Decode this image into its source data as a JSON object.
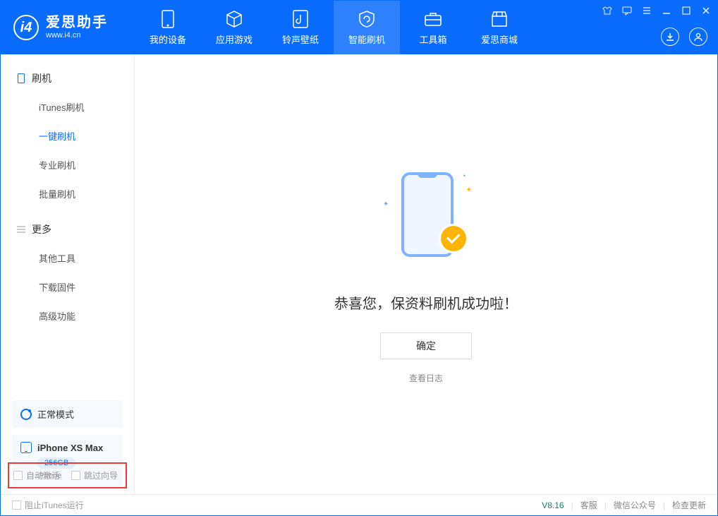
{
  "app": {
    "title": "爱思助手",
    "subtitle": "www.i4.cn"
  },
  "nav": {
    "items": [
      {
        "label": "我的设备"
      },
      {
        "label": "应用游戏"
      },
      {
        "label": "铃声壁纸"
      },
      {
        "label": "智能刷机"
      },
      {
        "label": "工具箱"
      },
      {
        "label": "爱思商城"
      }
    ]
  },
  "sidebar": {
    "group1": {
      "title": "刷机",
      "items": [
        "iTunes刷机",
        "一键刷机",
        "专业刷机",
        "批量刷机"
      ]
    },
    "group2": {
      "title": "更多",
      "items": [
        "其他工具",
        "下载固件",
        "高级功能"
      ]
    },
    "mode_label": "正常模式",
    "device": {
      "name": "iPhone XS Max",
      "storage": "256GB",
      "type": "iPhone"
    },
    "checkbox1": "自动激活",
    "checkbox2": "跳过向导"
  },
  "main": {
    "success_message": "恭喜您，保资料刷机成功啦！",
    "ok_button": "确定",
    "view_log": "查看日志"
  },
  "footer": {
    "block_itunes": "阻止iTunes运行",
    "version": "V8.16",
    "links": [
      "客服",
      "微信公众号",
      "检查更新"
    ]
  }
}
